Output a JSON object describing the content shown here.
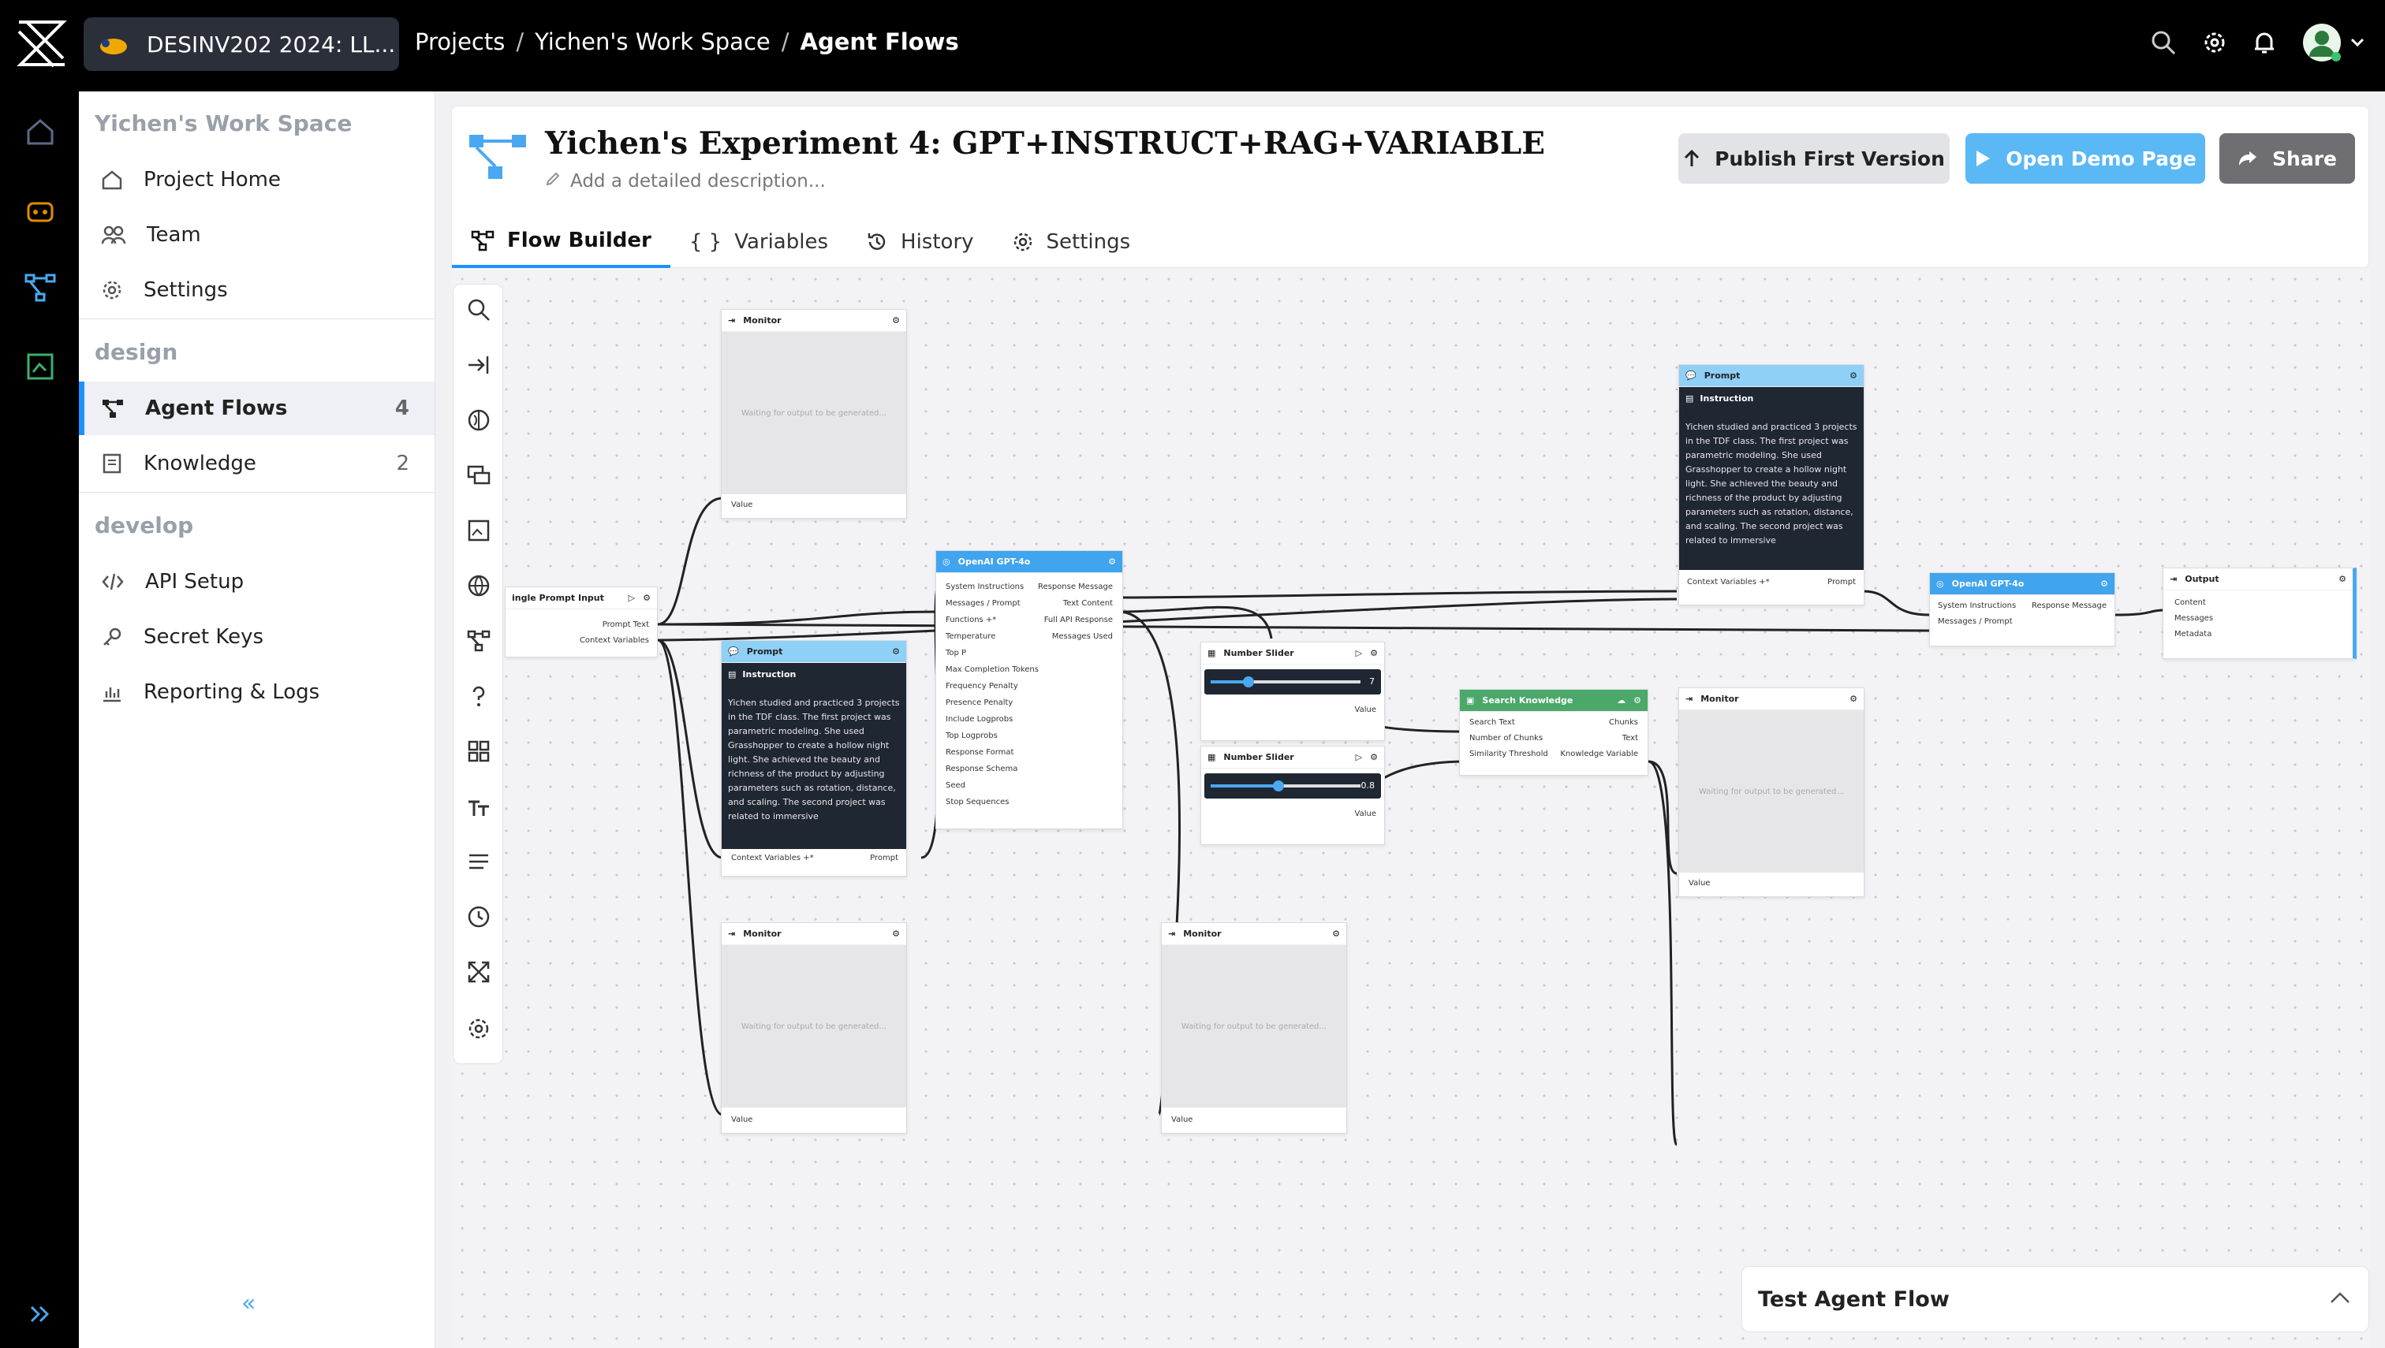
{
  "topbar": {
    "workspace_name": "DESINV202 2024: LL...",
    "breadcrumbs": [
      "Projects",
      "Yichen's Work Space",
      "Agent Flows"
    ],
    "icons": [
      "search-icon",
      "gear-icon",
      "bell-icon",
      "avatar"
    ]
  },
  "sidebar": {
    "workspace_title": "Yichen's Work Space",
    "top_items": [
      {
        "label": "Project Home",
        "icon": "home-icon"
      },
      {
        "label": "Team",
        "icon": "team-icon"
      },
      {
        "label": "Settings",
        "icon": "gear-icon"
      }
    ],
    "design_header": "design",
    "design_items": [
      {
        "label": "Agent Flows",
        "count": "4",
        "icon": "flow-icon",
        "active": true
      },
      {
        "label": "Knowledge",
        "count": "2",
        "icon": "book-icon"
      }
    ],
    "develop_header": "develop",
    "develop_items": [
      {
        "label": "API Setup",
        "icon": "code-icon"
      },
      {
        "label": "Secret Keys",
        "icon": "key-icon"
      },
      {
        "label": "Reporting & Logs",
        "icon": "chart-icon"
      }
    ],
    "collapse_glyph": "«"
  },
  "header": {
    "title": "Yichen's Experiment 4: GPT+INSTRUCT+RAG+VARIABLE",
    "description_placeholder": "Add a detailed description...",
    "buttons": {
      "publish": "Publish First Version",
      "demo": "Open Demo Page",
      "share": "Share"
    },
    "tabs": [
      "Flow Builder",
      "Variables",
      "History",
      "Settings"
    ],
    "active_tab": "Flow Builder"
  },
  "colors": {
    "accent": "#1e90ff",
    "demo_button": "#5ab8f5",
    "share_button": "#6f6f73",
    "publish_button": "#e2e3e7",
    "node_header_blue": "#8fd0f7",
    "node_header_blue_dark": "#40a4ee",
    "node_header_green": "#4ba86a"
  },
  "nodes": {
    "monitor_title": "Monitor",
    "monitor_waiting": "Waiting for output to be generated...",
    "monitor_value": "Value",
    "single_prompt": {
      "title": "ingle Prompt Input",
      "outputs": [
        "Prompt Text",
        "Context Variables"
      ]
    },
    "prompt_title": "Prompt",
    "instruction_label": "Instruction",
    "instruction_text": "Yichen studied and practiced 3 projects in the TDF class. The first project was parametric modeling. She used Grasshopper to create a hollow night light. She achieved the beauty and richness of the product by adjusting parameters such as rotation, distance, and scaling. The second project was related to immersive",
    "prompt_ports": [
      "Context Variables +*",
      "Prompt"
    ],
    "gpt": {
      "title": "OpenAI GPT-4o",
      "inputs": [
        "System Instructions",
        "Messages / Prompt",
        "Functions +*",
        "Temperature",
        "Top P",
        "Max Completion Tokens",
        "Frequency Penalty",
        "Presence Penalty",
        "Include Logprobs",
        "Top Logprobs",
        "Response Format",
        "Response Schema",
        "Seed",
        "Stop Sequences"
      ],
      "outputs": [
        "Response Message",
        "Text Content",
        "Full API Response",
        "Messages Used"
      ]
    },
    "gpt2": {
      "title": "OpenAI GPT-4o",
      "inputs": [
        "System Instructions",
        "Messages / Prompt"
      ],
      "outputs": [
        "Response Message"
      ]
    },
    "slider1": {
      "title": "Number Slider",
      "value": "7",
      "fill": 0.25,
      "port": "Value"
    },
    "slider2": {
      "title": "Number Slider",
      "value": "0.8",
      "fill": 0.45,
      "port": "Value"
    },
    "search": {
      "title": "Search Knowledge",
      "inputs": [
        "Search Text",
        "Number of Chunks",
        "Similarity Threshold"
      ],
      "outputs": [
        "Chunks",
        "Text",
        "Knowledge Variable"
      ]
    },
    "output": {
      "title": "Output",
      "inputs": [
        "Content",
        "Messages",
        "Metadata"
      ]
    }
  },
  "test_flow": {
    "label": "Test Agent Flow"
  }
}
